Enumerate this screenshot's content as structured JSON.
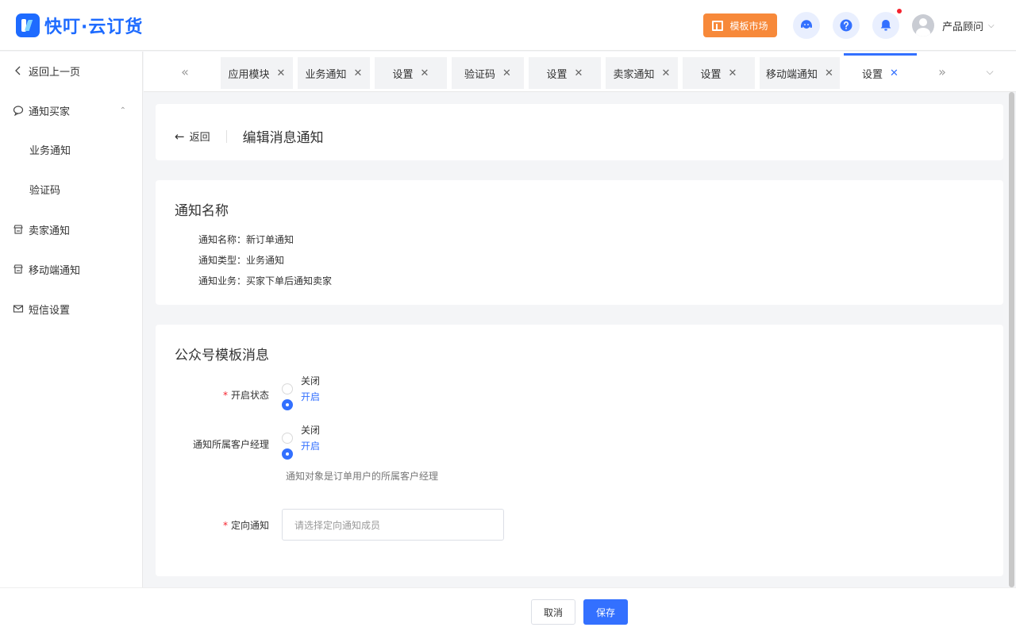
{
  "header": {
    "logo_text": "快叮·云订货",
    "market_label": "模板市场",
    "user_name": "产品顾问"
  },
  "sidebar": {
    "back_label": "返回上一页",
    "items": [
      {
        "label": "通知买家"
      },
      {
        "label": "业务通知"
      },
      {
        "label": "验证码"
      },
      {
        "label": "卖家通知"
      },
      {
        "label": "移动端通知"
      },
      {
        "label": "短信设置"
      }
    ]
  },
  "tabs": [
    {
      "label": "应用模块"
    },
    {
      "label": "业务通知"
    },
    {
      "label": "设置"
    },
    {
      "label": "验证码"
    },
    {
      "label": "设置"
    },
    {
      "label": "卖家通知"
    },
    {
      "label": "设置"
    },
    {
      "label": "移动端通知"
    },
    {
      "label": "设置"
    }
  ],
  "page": {
    "back_label": "返回",
    "title": "编辑消息通知"
  },
  "info": {
    "title": "通知名称",
    "rows": [
      {
        "label": "通知名称：",
        "value": "新订单通知"
      },
      {
        "label": "通知类型：",
        "value": "业务通知"
      },
      {
        "label": "通知业务：",
        "value": "买家下单后通知卖家"
      }
    ]
  },
  "template": {
    "title": "公众号模板消息",
    "status": {
      "label": "开启状态",
      "off": "关闭",
      "on": "开启",
      "selected": "开启"
    },
    "manager": {
      "label": "通知所属客户经理",
      "off": "关闭",
      "on": "开启",
      "selected": "开启",
      "hint": "通知对象是订单用户的所属客户经理"
    },
    "directed": {
      "label": "定向通知",
      "placeholder": "请选择定向通知成员"
    }
  },
  "footer": {
    "cancel_label": "取消",
    "save_label": "保存"
  },
  "colors": {
    "primary": "#3370ff",
    "market": "#f7893a",
    "required": "#f5222d"
  }
}
